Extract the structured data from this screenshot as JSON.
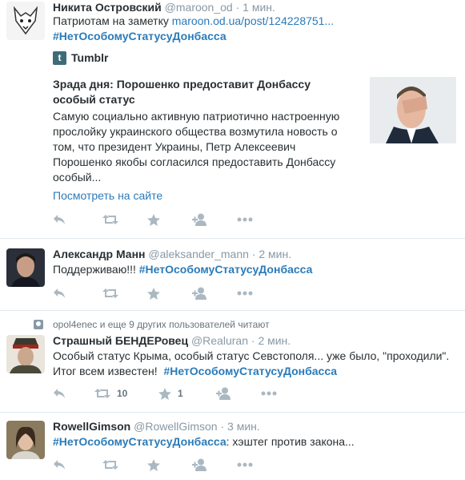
{
  "tweets": [
    {
      "name": "Никита Островский",
      "handle": "@maroon_od",
      "dot": "·",
      "time": "1 мин.",
      "text_prefix": "Патриотам на заметку ",
      "link": "maroon.od.ua/post/124228751...",
      "hashtag": "#НетОсобомуСтатусуДонбасса",
      "card": {
        "site": "Tumblr",
        "title": "Зрада дня: Порошенко предоставит Донбассу особый статус",
        "desc_lines": [
          "Самую социально активную патриотично настроенную",
          "прослойку украинского общества возмутила новость о",
          "том, что президент Украины, Петр Алексеевич",
          "Порошенко якобы согласился предоставить Донбассу",
          "особый..."
        ],
        "view_link": "Посмотреть на сайте"
      }
    },
    {
      "name": "Александр Манн",
      "handle": "@aleksander_mann",
      "dot": "·",
      "time": "2 мин.",
      "text_prefix": "Поддерживаю!!! ",
      "hashtag": "#НетОсобомуСтатусуДонбасса"
    },
    {
      "context": "opol4enec и еще 9 других пользователей читают",
      "name": "Страшный БЕНДЕРовец",
      "handle": "@Realuran",
      "dot": "·",
      "time": "2 мин.",
      "line1": "Особый статус Крыма, особый статус Севстополя... уже было, \"проходили\".",
      "line2_prefix": "Итог всем известен!  ",
      "hashtag": "#НетОсобомуСтатусуДонбасса",
      "retweets": "10",
      "favorites": "1"
    },
    {
      "name": "RowellGimson",
      "handle": "@RowellGimson",
      "dot": "·",
      "time": "3 мин.",
      "hashtag": "#НетОсобомуСтатусуДонбасса",
      "text_suffix": ": хэштег против закона..."
    }
  ],
  "icons": {
    "reply": "reply-icon",
    "retweet": "retweet-icon",
    "favorite": "star-icon",
    "follow": "follow-icon",
    "more": "more-icon"
  },
  "colors": {
    "link": "#2b7bb9",
    "action_icon": "#aab8c2",
    "muted": "#8899a6"
  }
}
